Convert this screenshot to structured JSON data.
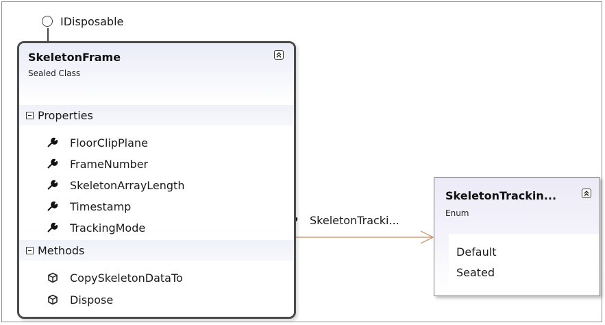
{
  "interface": {
    "name": "IDisposable"
  },
  "class_shape": {
    "name": "SkeletonFrame",
    "kind": "Sealed Class",
    "properties_header": "Properties",
    "properties": [
      {
        "name": "FloorClipPlane",
        "icon": "wrench-property-icon"
      },
      {
        "name": "FrameNumber",
        "icon": "wrench-property-icon"
      },
      {
        "name": "SkeletonArrayLength",
        "icon": "wrench-property-icon"
      },
      {
        "name": "Timestamp",
        "icon": "wrench-property-icon"
      },
      {
        "name": "TrackingMode",
        "icon": "wrench-property-icon"
      }
    ],
    "methods_header": "Methods",
    "methods": [
      {
        "name": "CopySkeletonDataTo",
        "icon": "method-cube-icon"
      },
      {
        "name": "Dispose",
        "icon": "method-cube-icon"
      }
    ]
  },
  "association": {
    "label": "SkeletonTracki...",
    "line_color": "#c8875a"
  },
  "enum_shape": {
    "name": "SkeletonTrackin...",
    "kind": "Enum",
    "values": [
      "Default",
      "Seated"
    ]
  },
  "colors": {
    "header_gradient": "#e9ebf7",
    "class_border": "#4a4a4a",
    "enum_gradient": "#eceaf6"
  }
}
